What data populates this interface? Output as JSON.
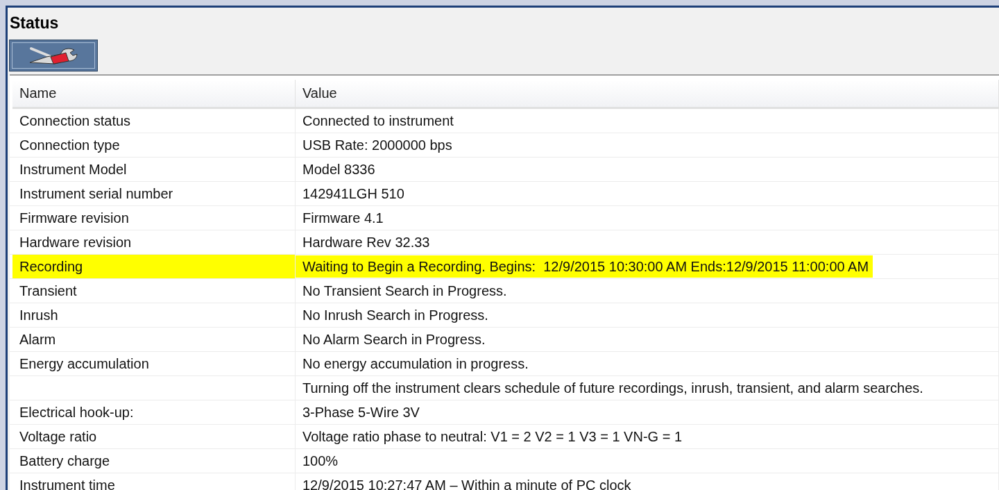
{
  "panel": {
    "title": "Status"
  },
  "toolbar": {
    "buttons": [
      {
        "kind": "tools"
      }
    ]
  },
  "table": {
    "columns": [
      "Name",
      "Value"
    ],
    "rows": [
      {
        "name": "Connection status",
        "value": "Connected to instrument",
        "highlighted": false
      },
      {
        "name": "Connection type",
        "value": "USB Rate: 2000000 bps",
        "highlighted": false
      },
      {
        "name": "Instrument Model",
        "value": "Model 8336",
        "highlighted": false
      },
      {
        "name": "Instrument serial number",
        "value": "142941LGH 510",
        "highlighted": false
      },
      {
        "name": "Firmware revision",
        "value": "Firmware 4.1",
        "highlighted": false
      },
      {
        "name": "Hardware revision",
        "value": "Hardware Rev 32.33",
        "highlighted": false
      },
      {
        "name": "Recording",
        "value": "Waiting to Begin a Recording. Begins:  12/9/2015 10:30:00 AM Ends:12/9/2015 11:00:00 AM",
        "highlighted": true
      },
      {
        "name": "Transient",
        "value": "No Transient Search in Progress.",
        "highlighted": false
      },
      {
        "name": "Inrush",
        "value": "No Inrush Search in Progress.",
        "highlighted": false
      },
      {
        "name": "Alarm",
        "value": "No Alarm Search in Progress.",
        "highlighted": false
      },
      {
        "name": "Energy accumulation",
        "value": "No energy accumulation in progress.",
        "highlighted": false
      },
      {
        "value": "Turning off the instrument clears schedule of future recordings, inrush, transient, and alarm searches.",
        "highlighted": false
      },
      {
        "name": "Electrical hook-up:",
        "value": "3-Phase 5-Wire 3V",
        "highlighted": false
      },
      {
        "name": "Voltage ratio",
        "value": "Voltage ratio phase to neutral: V1 = 2 V2 = 1 V3 = 1 VN-G = 1",
        "highlighted": false
      },
      {
        "name": "Battery charge",
        "value": "100%",
        "highlighted": false
      },
      {
        "name": "Instrument time",
        "value": "12/9/2015 10:27:47 AM – Within a minute of PC clock",
        "highlighted": false
      }
    ]
  }
}
